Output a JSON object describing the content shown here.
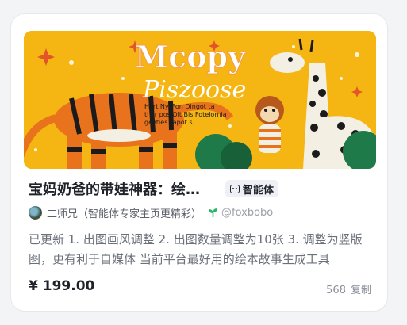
{
  "card": {
    "cover_title": "Mcopy",
    "cover_subtitle": "Piszoose",
    "cover_caption_1": "Hort Ny. Fon Dingot ta",
    "cover_caption_2": "ti or pos Olt Bis Fotelornia",
    "cover_caption_3": "geeties Fapot s",
    "title": "宝妈奶爸的带娃神器：绘本故事生成",
    "badge": {
      "icon": "robot-icon",
      "label": "智能体"
    },
    "author": {
      "name": "二师兄（智能体专家主页更精彩）",
      "handle": "@foxbobo",
      "verified_icon": "sprout-icon"
    },
    "description": "已更新 1. 出图画风调整 2. 出图数量调整为10张 3. 调整为竖版图，更有利于自媒体 当前平台最好用的绘本故事生成工具",
    "price": "¥ 199.00",
    "copies_count": "568",
    "copies_label": "复制"
  },
  "colors": {
    "cover_background": "#f5b512",
    "tiger_orange": "#e8731c",
    "giraffe_white": "#f4efe3",
    "tree_green": "#1f7a4a"
  }
}
